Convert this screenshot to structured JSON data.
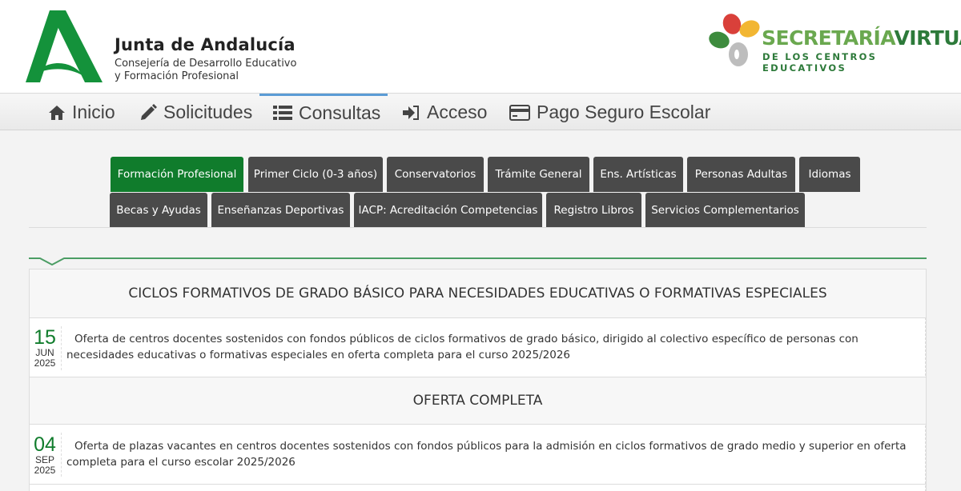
{
  "header": {
    "org_name": "Junta de Andalucía",
    "org_sub1": "Consejería de Desarrollo Educativo",
    "org_sub2": "y Formación Profesional",
    "sv_title_a": "SECRETARÍA",
    "sv_title_b": "VIRTUAL",
    "sv_sub": "DE LOS CENTROS EDUCATIVOS"
  },
  "nav": {
    "items": [
      {
        "label": "Inicio",
        "icon": "home-icon"
      },
      {
        "label": "Solicitudes",
        "icon": "pencil-icon"
      },
      {
        "label": "Consultas",
        "icon": "list-icon"
      },
      {
        "label": "Acceso",
        "icon": "sign-in-icon"
      },
      {
        "label": "Pago Seguro Escolar",
        "icon": "credit-card-icon"
      }
    ],
    "active": "Consultas"
  },
  "tabs": {
    "row1": [
      "Formación Profesional",
      "Primer Ciclo (0-3 años)",
      "Conservatorios",
      "Trámite General",
      "Ens. Artísticas",
      "Personas Adultas",
      "Idiomas"
    ],
    "row2": [
      "Becas y Ayudas",
      "Enseñanzas Deportivas",
      "IACP: Acreditación Competencias",
      "Registro Libros",
      "Servicios Complementarios"
    ],
    "active": "Formación Profesional"
  },
  "content": {
    "section1_title": "CICLOS FORMATIVOS DE GRADO BÁSICO PARA NECESIDADES EDUCATIVAS O FORMATIVAS ESPECIALES",
    "item1": {
      "day": "15",
      "month": "JUN",
      "year": "2025",
      "text": "Oferta de centros docentes sostenidos con fondos públicos de ciclos formativos de grado básico, dirigido al colectivo específico de personas con necesidades educativas o formativas especiales en oferta completa para el curso 2025/2026"
    },
    "section2_title": "OFERTA COMPLETA",
    "item2": {
      "day": "04",
      "month": "SEP",
      "year": "2025",
      "text": "Oferta de plazas vacantes en centros docentes sostenidos con fondos públicos para la admisión en ciclos formativos de grado medio y superior en oferta completa para el curso escolar 2025/2026"
    }
  },
  "colors": {
    "accent_green": "#107c2c",
    "tab_dark": "#4a4a4a",
    "nav_active": "#5b9bd5"
  }
}
